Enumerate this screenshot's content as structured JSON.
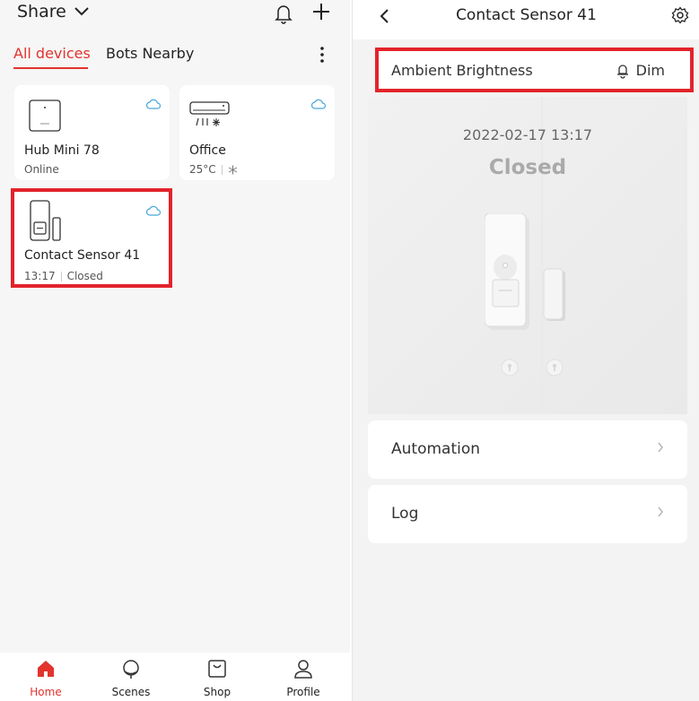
{
  "left": {
    "header": {
      "title": "Share"
    },
    "tabs": [
      {
        "label": "All devices",
        "active": true
      },
      {
        "label": "Bots Nearby",
        "active": false
      }
    ],
    "devices": [
      {
        "name": "Hub Mini 78",
        "status": "Online",
        "icon": "hub-icon",
        "cloud": true
      },
      {
        "name": "Office",
        "status": "25°C",
        "mode_icon": "snowflake-icon",
        "icon": "air-conditioner-icon",
        "cloud": true
      },
      {
        "name": "Contact Sensor 41",
        "time": "13:17",
        "status": "Closed",
        "icon": "contact-sensor-icon",
        "cloud": true,
        "highlighted": true
      }
    ],
    "tabbar": [
      {
        "label": "Home",
        "icon": "home-icon",
        "active": true
      },
      {
        "label": "Scenes",
        "icon": "scenes-icon",
        "active": false
      },
      {
        "label": "Shop",
        "icon": "shop-icon",
        "active": false
      },
      {
        "label": "Profile",
        "icon": "profile-icon",
        "active": false
      }
    ]
  },
  "right": {
    "header": {
      "title": "Contact Sensor 41"
    },
    "ambient": {
      "label": "Ambient Brightness",
      "value": "Dim",
      "icon": "bulb-icon",
      "highlighted": true
    },
    "hero": {
      "timestamp": "2022-02-17 13:17",
      "state": "Closed"
    },
    "rows": [
      {
        "label": "Automation"
      },
      {
        "label": "Log"
      }
    ]
  },
  "colors": {
    "accent": "#e2332d",
    "highlight": "#e3232b",
    "cloud": "#4aa8d8"
  }
}
